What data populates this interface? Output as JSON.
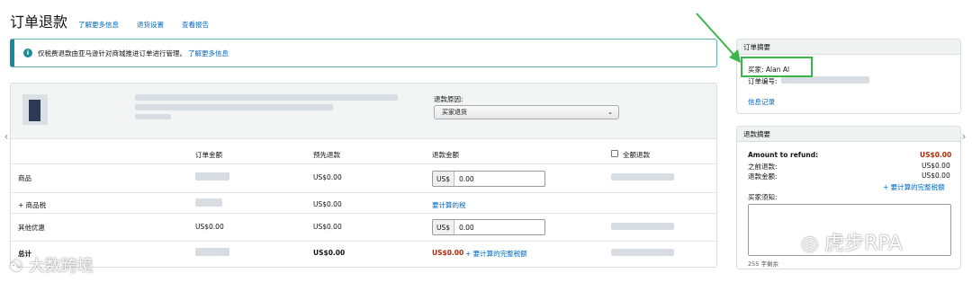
{
  "header": {
    "title": "订单退款",
    "links": [
      "了解更多信息",
      "退货设置",
      "查看报告"
    ]
  },
  "banner": {
    "icon": "info-icon",
    "text": "仅税费退款由亚马逊针对商城推进订单进行管理。",
    "link": "了解更多信息"
  },
  "product": {
    "reason_label": "退款原因:",
    "reason_selected": "买家退货"
  },
  "table": {
    "columns": [
      "订单金额",
      "预先退款",
      "退款金额",
      "全额退款"
    ],
    "rows": [
      {
        "label": "商品",
        "order_amount": "",
        "prev_refund": "US$0.00",
        "currency": "US$",
        "refund_value": "0.00"
      },
      {
        "label": "+ 商品税",
        "order_amount": "",
        "prev_refund": "US$0.00",
        "link": "要计算的税"
      },
      {
        "label": "其他优惠",
        "order_amount": "US$0.00",
        "prev_refund": "US$0.00",
        "currency": "US$",
        "refund_value": "0.00"
      }
    ],
    "total": {
      "label": "总计",
      "prev_refund": "US$0.00",
      "refund": "US$0.00",
      "link": "+ 要计算的完整税额"
    }
  },
  "order_summary": {
    "title": "订单摘要",
    "buyer": "买家: Alan Al",
    "order_no_label": "订单编号:",
    "message_link": "信息记录"
  },
  "refund_summary": {
    "title": "退款摘要",
    "amount_label": "Amount to refund:",
    "amount_value": "US$0.00",
    "prev_label": "之前退款:",
    "prev_value": "US$0.00",
    "refund_label": "退款金额:",
    "refund_value": "US$0.00",
    "tax_link": "+ 要计算的完整税额",
    "note_label": "买家须知:",
    "char_count": "255 字剩余"
  },
  "watermarks": {
    "left": "大数跨境",
    "right": "虎步RPA"
  }
}
